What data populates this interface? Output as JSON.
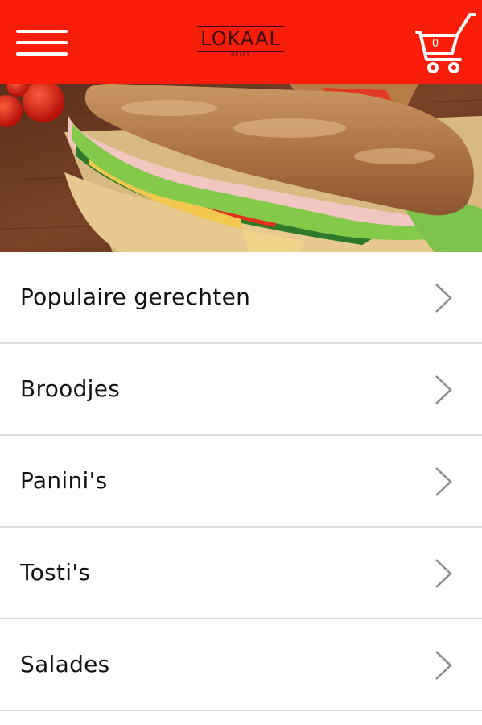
{
  "header": {
    "brand": "LOKAAL",
    "brand_sub": "DELFT",
    "cart_count": "0",
    "background": "#f91d0a",
    "menu_icon": "hamburger-icon",
    "cart_icon": "shopping-cart-icon"
  },
  "categories": [
    {
      "label": "Populaire gerechten"
    },
    {
      "label": "Broodjes"
    },
    {
      "label": "Panini's"
    },
    {
      "label": "Tosti's"
    },
    {
      "label": "Salades"
    }
  ]
}
